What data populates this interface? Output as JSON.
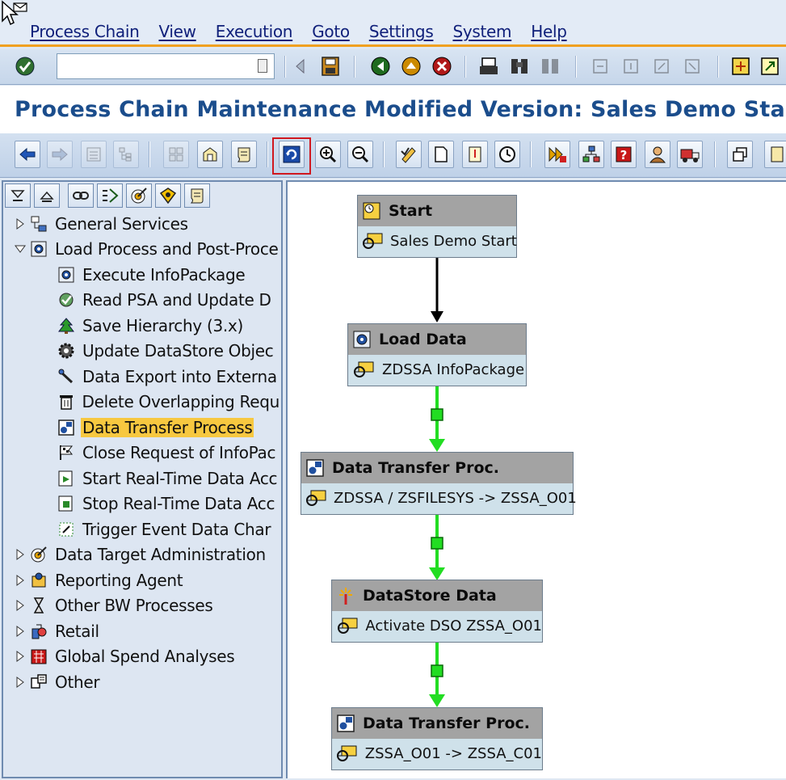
{
  "menubar": {
    "items": [
      "Process Chain",
      "View",
      "Execution",
      "Goto",
      "Settings",
      "System",
      "Help"
    ]
  },
  "systoolbar": {
    "command_value": ""
  },
  "title": "Process Chain Maintenance Modified Version: Sales Demo Start I",
  "tree": {
    "level1_top": [
      {
        "label": "General Services",
        "icon": "services-icon"
      },
      {
        "label": "Load Process and Post-Proce",
        "icon": "load-process-icon"
      }
    ],
    "children": [
      {
        "label": "Execute InfoPackage",
        "icon": "infopackage-icon"
      },
      {
        "label": "Read PSA and Update D",
        "icon": "read-psa-icon"
      },
      {
        "label": "Save Hierarchy (3.x)",
        "icon": "hierarchy-icon"
      },
      {
        "label": "Update DataStore Objec",
        "icon": "gear-icon"
      },
      {
        "label": "Data Export into Externa",
        "icon": "export-icon"
      },
      {
        "label": "Delete Overlapping Requ",
        "icon": "trash-icon"
      },
      {
        "label": "Data Transfer Process",
        "icon": "dtp-icon"
      },
      {
        "label": "Close Request of InfoPac",
        "icon": "flag-icon"
      },
      {
        "label": "Start Real-Time Data Acc",
        "icon": "start-rt-icon"
      },
      {
        "label": "Stop Real-Time Data Acc",
        "icon": "stop-rt-icon"
      },
      {
        "label": "Trigger Event Data Char",
        "icon": "trigger-icon"
      }
    ],
    "level1_bottom": [
      {
        "label": "Data Target Administration",
        "icon": "target-icon"
      },
      {
        "label": "Reporting Agent",
        "icon": "agent-icon"
      },
      {
        "label": "Other BW Processes",
        "icon": "hourglass-icon"
      },
      {
        "label": "Retail",
        "icon": "retail-icon"
      },
      {
        "label": "Global Spend Analyses",
        "icon": "spend-icon"
      },
      {
        "label": "Other",
        "icon": "other-icon"
      }
    ],
    "selected": "Data Transfer Process"
  },
  "processes": [
    {
      "title": "Start",
      "detail": "Sales Demo Start",
      "icon": "start-clock-icon"
    },
    {
      "title": "Load Data",
      "detail": "ZDSSA InfoPackage",
      "icon": "load-data-icon"
    },
    {
      "title": "Data Transfer Proc.",
      "detail": "ZDSSA / ZSFILESYS -> ZSSA_O01",
      "icon": "dtp-icon"
    },
    {
      "title": "DataStore Data",
      "detail": "Activate DSO ZSSA_O01",
      "icon": "datastore-icon"
    },
    {
      "title": "Data Transfer Proc.",
      "detail": "ZSSA_O01 -> ZSSA_C01",
      "icon": "dtp-icon"
    }
  ],
  "colors": {
    "link_success": "#22dd22",
    "link_always": "#000000",
    "highlight": "#d0181f",
    "selected": "#f7c840",
    "title": "#1b4d8c"
  }
}
